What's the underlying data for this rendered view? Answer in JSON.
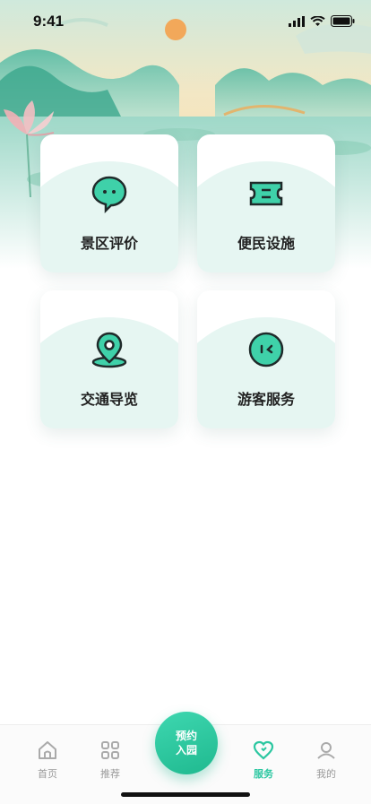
{
  "status_bar": {
    "time": "9:41"
  },
  "services": [
    {
      "label": "景区评价",
      "icon": "chat-bubble-icon"
    },
    {
      "label": "便民设施",
      "icon": "ticket-icon"
    },
    {
      "label": "交通导览",
      "icon": "map-pin-icon"
    },
    {
      "label": "游客服务",
      "icon": "service-face-icon"
    }
  ],
  "tabbar": {
    "home": "首页",
    "recommend": "推荐",
    "reserve_line1": "预约",
    "reserve_line2": "入园",
    "service": "服务",
    "mine": "我的",
    "active": "service"
  },
  "colors": {
    "accent": "#2cc7a1",
    "card_tint": "#e6f6f2",
    "dark": "#1f2a2a"
  }
}
